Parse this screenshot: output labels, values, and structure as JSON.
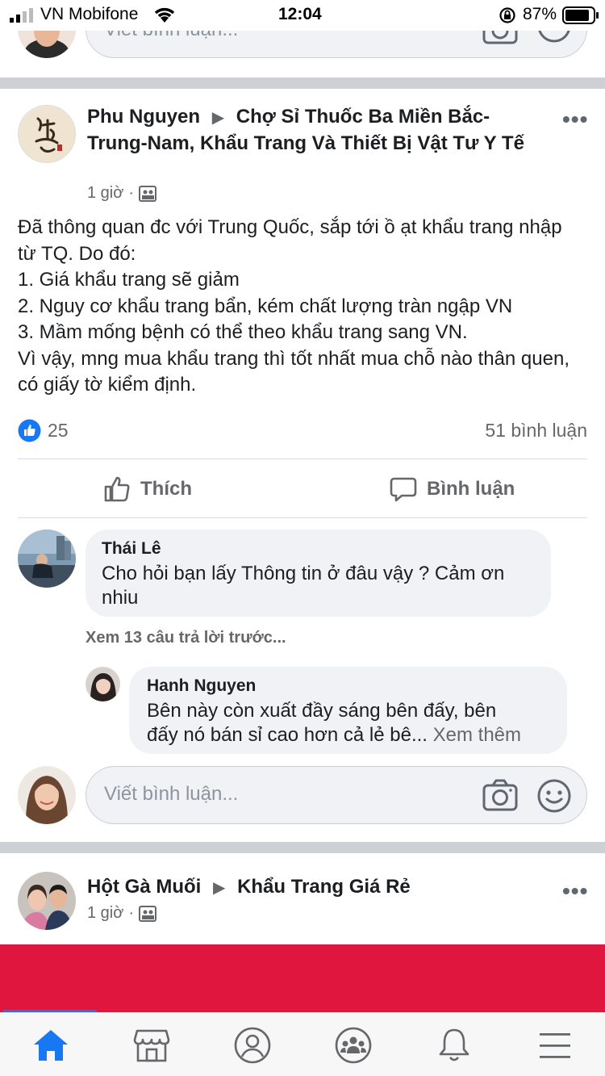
{
  "status_bar": {
    "carrier": "VN Mobifone",
    "time": "12:04",
    "battery": "87%"
  },
  "top_comment_input": {
    "placeholder": "Viết bình luận..."
  },
  "post": {
    "author": "Phu Nguyen",
    "group": "Chợ Sỉ Thuốc Ba Miền Bắc-Trung-Nam, Khẩu Trang Và Thiết Bị Vật Tư Y Tế",
    "time": "1 giờ",
    "separator": "·",
    "body_lines": [
      "Đã thông quan đc với Trung Quốc, sắp tới ồ ạt khẩu trang nhập từ TQ. Do đó:",
      "1. Giá khẩu trang sẽ giảm",
      "2. Nguy cơ khẩu trang bẩn, kém chất lượng tràn ngập VN",
      "3. Mầm mống bệnh có thể theo khẩu trang sang VN.",
      "Vì vậy, mng mua khẩu trang thì tốt nhất mua chỗ nào thân quen, có giấy tờ kiểm định."
    ],
    "reactions_count": "25",
    "comments_count": "51 bình luận",
    "like_label": "Thích",
    "comment_label": "Bình luận"
  },
  "comments": [
    {
      "author": "Thái Lê",
      "text": "Cho hỏi bạn lấy Thông tin ở đâu vậy ? Cảm ơn nhiu"
    }
  ],
  "view_previous_replies": "Xem 13 câu trả lời trước...",
  "reply": {
    "author": "Hanh Nguyen",
    "text_line1": "Bên này còn xuất đầy sáng bên đấy, bên",
    "text_line2": "đấy nó bán sỉ cao hơn cả lẻ bê...",
    "see_more": "Xem thêm"
  },
  "comment_input": {
    "placeholder": "Viết bình luận..."
  },
  "next_post": {
    "author": "Hột Gà Muối",
    "group": "Khẩu Trang Giá Rẻ",
    "time": "1 giờ",
    "separator": "·"
  },
  "tabbar": {
    "tabs": [
      "home",
      "marketplace",
      "profile",
      "groups",
      "notifications",
      "menu"
    ],
    "active": "home"
  },
  "colors": {
    "accent": "#1877f2",
    "banner": "#e0163f",
    "divider": "#cdd0d4"
  }
}
